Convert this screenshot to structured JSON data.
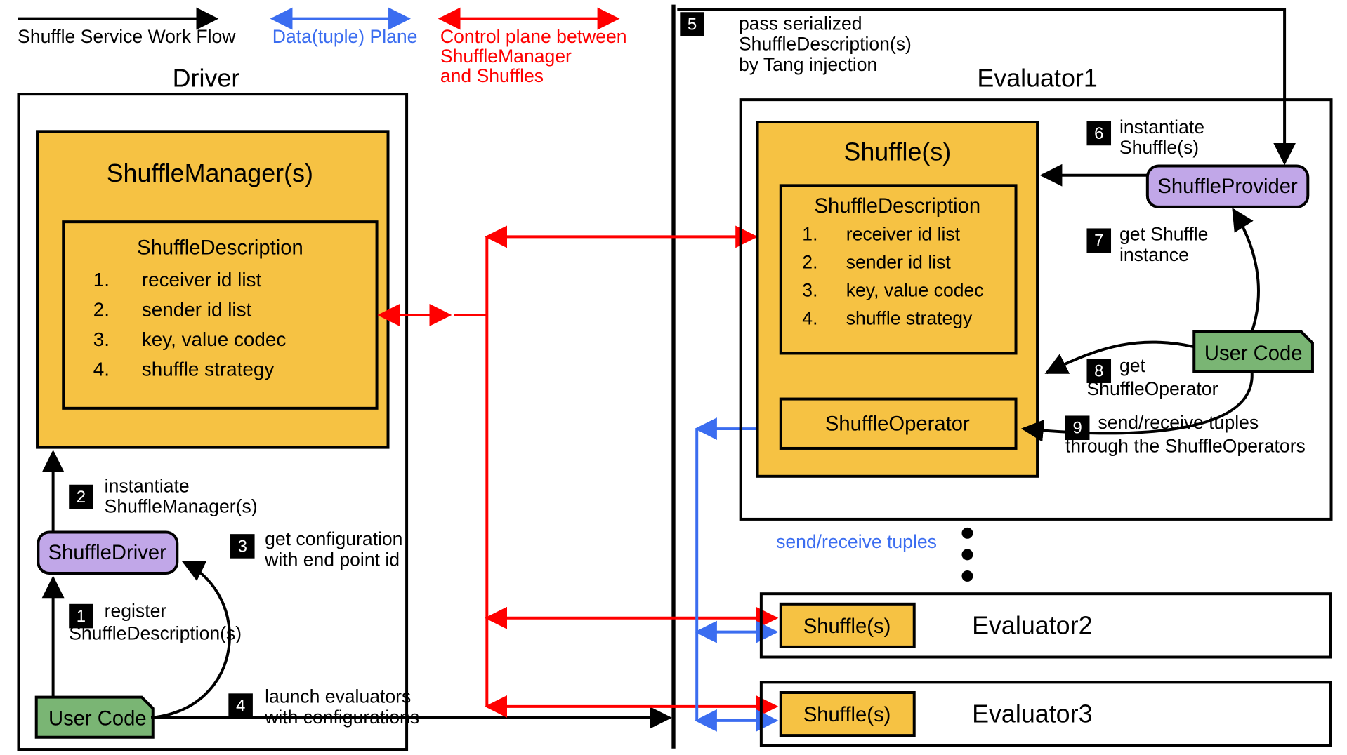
{
  "legend": {
    "workflow": "Shuffle Service Work Flow",
    "dataplane": "Data(tuple) Plane",
    "controlplane1": "Control plane between",
    "controlplane2": "ShuffleManager",
    "controlplane3": "and Shuffles"
  },
  "driver": {
    "title": "Driver",
    "managerTitle": "ShuffleManager(s)",
    "descTitle": "ShuffleDescription",
    "desc": {
      "n1": "1.",
      "v1": "receiver id list",
      "n2": "2.",
      "v2": "sender id list",
      "n3": "3.",
      "v3": "key, value codec",
      "n4": "4.",
      "v4": "shuffle strategy"
    },
    "shuffleDriver": "ShuffleDriver",
    "userCode": "User Code",
    "step1": {
      "n": "1",
      "l1": "register",
      "l2": "ShuffleDescription(s)"
    },
    "step2": {
      "n": "2",
      "l1": "instantiate",
      "l2": "ShuffleManager(s)"
    },
    "step3": {
      "n": "3",
      "l1": "get configuration",
      "l2": "with end point id"
    },
    "step4": {
      "n": "4",
      "l1": "launch evaluators",
      "l2": "with configurations"
    }
  },
  "right": {
    "eval1": "Evaluator1",
    "eval2": "Evaluator2",
    "eval3": "Evaluator3",
    "shuffles": "Shuffle(s)",
    "shuffleOperator": "ShuffleOperator",
    "shuffleProvider": "ShuffleProvider",
    "userCode": "User Code",
    "sendRecv": "send/receive tuples",
    "descTitle": "ShuffleDescription",
    "desc": {
      "n1": "1.",
      "v1": "receiver id list",
      "n2": "2.",
      "v2": "sender id list",
      "n3": "3.",
      "v3": "key, value codec",
      "n4": "4.",
      "v4": "shuffle strategy"
    },
    "step5": {
      "n": "5",
      "l1": "pass serialized",
      "l2": "ShuffleDescription(s)",
      "l3": "by Tang injection"
    },
    "step6": {
      "n": "6",
      "l1": "instantiate",
      "l2": "Shuffle(s)"
    },
    "step7": {
      "n": "7",
      "l1": "get Shuffle",
      "l2": "instance"
    },
    "step8": {
      "n": "8",
      "l1": "get",
      "l2": "ShuffleOperator"
    },
    "step9": {
      "n": "9",
      "l1": "send/receive tuples",
      "l2": "through the ShuffleOperators"
    }
  }
}
